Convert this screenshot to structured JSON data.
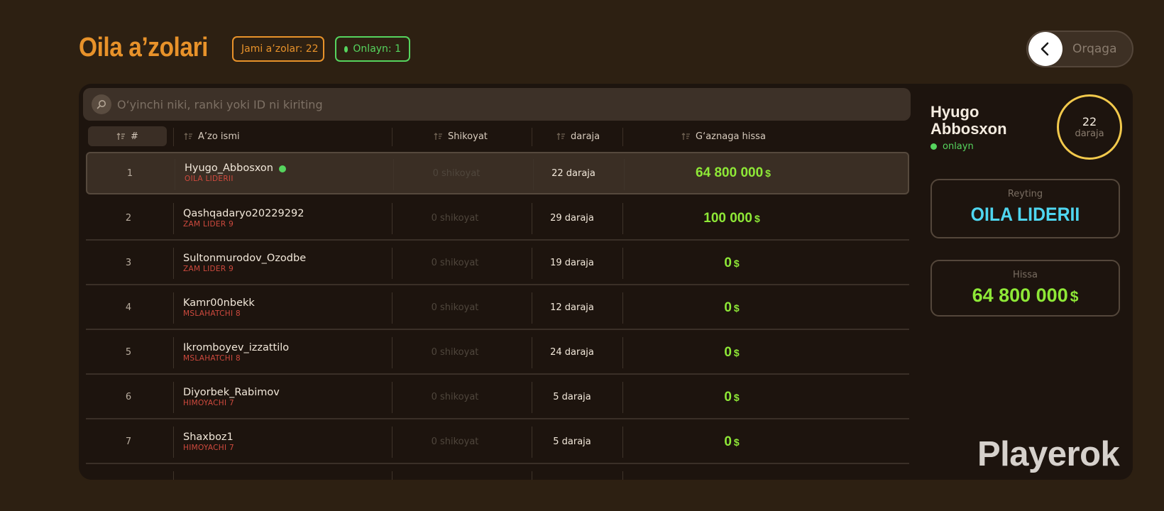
{
  "header": {
    "title": "Oila a’zolari",
    "total_badge": "Jami a’zolar: 22",
    "online_badge": "Onlayn: 1",
    "back_label": "Orqaga"
  },
  "search": {
    "placeholder": "O‘yinchi niki, ranki yoki ID ni kiriting",
    "value": ""
  },
  "table": {
    "columns": [
      "#",
      "A’zo ismi",
      "Shikoyat",
      "daraja",
      "G‘aznaga hissa"
    ],
    "currency": "$",
    "rows": [
      {
        "num": "1",
        "name": "Hyugo_Abbosxon",
        "rank": "OILA LIDERII",
        "complaints": "0 shikoyat",
        "level": "22 daraja",
        "contribution": "64 800 000",
        "online": true,
        "selected": true
      },
      {
        "num": "2",
        "name": "Qashqadaryo20229292",
        "rank": "ZAM LIDER 9",
        "complaints": "0 shikoyat",
        "level": "29 daraja",
        "contribution": "100 000",
        "online": false,
        "selected": false
      },
      {
        "num": "3",
        "name": "Sultonmurodov_Ozodbe",
        "rank": "ZAM LIDER 9",
        "complaints": "0 shikoyat",
        "level": "19 daraja",
        "contribution": "0",
        "online": false,
        "selected": false
      },
      {
        "num": "4",
        "name": "Kamr00nbekk",
        "rank": "MSLAHATCHI 8",
        "complaints": "0 shikoyat",
        "level": "12 daraja",
        "contribution": "0",
        "online": false,
        "selected": false
      },
      {
        "num": "5",
        "name": "Ikromboyev_izzattilo",
        "rank": "MSLAHATCHI 8",
        "complaints": "0 shikoyat",
        "level": "24 daraja",
        "contribution": "0",
        "online": false,
        "selected": false
      },
      {
        "num": "6",
        "name": "Diyorbek_Rabimov",
        "rank": "HIMOYACHI 7",
        "complaints": "0 shikoyat",
        "level": "5 daraja",
        "contribution": "0",
        "online": false,
        "selected": false
      },
      {
        "num": "7",
        "name": "Shaxboz1",
        "rank": "HIMOYACHI 7",
        "complaints": "0 shikoyat",
        "level": "5 daraja",
        "contribution": "0",
        "online": false,
        "selected": false
      }
    ]
  },
  "profile": {
    "name": "Hyugo Abbosxon",
    "status": "onlayn",
    "level_value": "22",
    "level_label": "daraja",
    "rating_label": "Reyting",
    "rating_value": "OILA LIDERII",
    "share_label": "Hissa",
    "share_value": "64 800 000",
    "currency": "$"
  },
  "watermark": "Playerok",
  "colors": {
    "accent": "#e8922a",
    "online": "#56d45e",
    "money": "#8ee837",
    "rank": "#cf4a3e",
    "rating": "#4fd6f0",
    "level_ring": "#f2c94c"
  }
}
